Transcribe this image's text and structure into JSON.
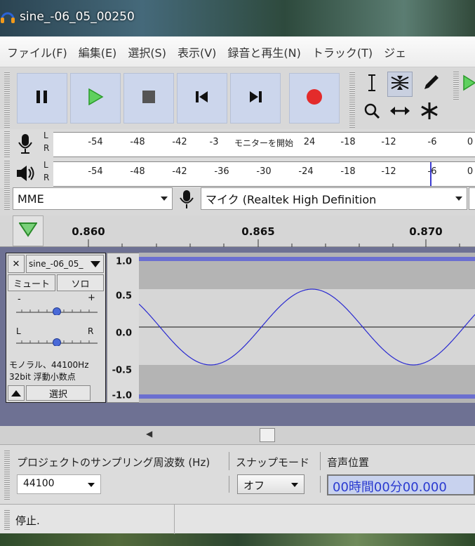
{
  "window_title": "sine_-06_05_00250",
  "menu": [
    "ファイル(F)",
    "編集(E)",
    "選択(S)",
    "表示(V)",
    "録音と再生(N)",
    "トラック(T)",
    "ジェ"
  ],
  "transport": {
    "pause": "pause-icon",
    "play": "play-icon",
    "stop": "stop-icon",
    "skip_start": "skip-start-icon",
    "skip_end": "skip-end-icon",
    "record": "record-icon"
  },
  "tools": [
    "selection-tool-icon",
    "envelope-tool-icon",
    "draw-tool-icon",
    "zoom-tool-icon",
    "timeshift-tool-icon",
    "multi-tool-icon"
  ],
  "record_meter": {
    "left": "L",
    "right": "R",
    "ticks": [
      "-54",
      "-48",
      "-42",
      "-3",
      "24",
      "-18",
      "-12",
      "-6",
      "0"
    ],
    "hint": "モニターを開始"
  },
  "play_meter": {
    "left": "L",
    "right": "R",
    "ticks": [
      "-54",
      "-48",
      "-42",
      "-36",
      "-30",
      "-24",
      "-18",
      "-12",
      "-6",
      "0"
    ]
  },
  "host": "MME",
  "input_device": "マイク (Realtek High Definition",
  "ruler": {
    "ticks": [
      "0.860",
      "0.865",
      "0.870"
    ]
  },
  "track": {
    "name": "sine_-06_05_",
    "mute": "ミュート",
    "solo": "ソロ",
    "gain_minus": "-",
    "gain_plus": "+",
    "pan_left": "L",
    "pan_right": "R",
    "info_line1": "モノラル、44100Hz",
    "info_line2": "32bit 浮動小数点",
    "select": "選択"
  },
  "vertical_scale": [
    "1.0",
    "0.5",
    "0.0",
    "-0.5",
    "-1.0"
  ],
  "bottom": {
    "rate_label": "プロジェクトのサンプリング周波数 (Hz)",
    "rate_value": "44100",
    "snap_label": "スナップモード",
    "snap_value": "オフ",
    "pos_label": "音声位置",
    "pos_value": "00時間00分00.000"
  },
  "status_text": "停止.",
  "colors": {
    "transport_bg": "#ccd6ec",
    "play": "#3fb93f",
    "record": "#e32b2b",
    "wave": "#3c3cc8",
    "track_bg": "#6e7193"
  }
}
